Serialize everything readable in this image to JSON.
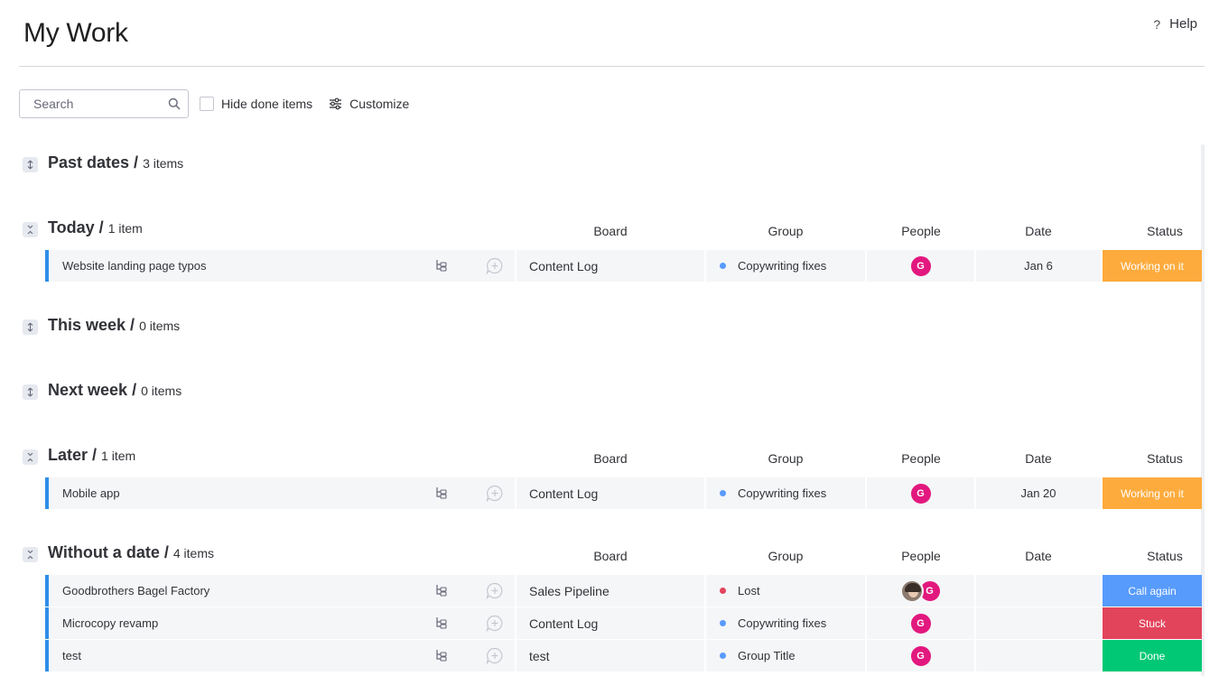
{
  "header": {
    "title": "My Work",
    "help_icon": "?",
    "help_label": "Help"
  },
  "toolbar": {
    "search_placeholder": "Search",
    "hide_done_label": "Hide done items",
    "customize_label": "Customize"
  },
  "columns": {
    "board": "Board",
    "group": "Group",
    "people": "People",
    "date": "Date",
    "status": "Status"
  },
  "groups": [
    {
      "title": "Past dates",
      "count": "3 items",
      "expanded": false
    },
    {
      "title": "Today",
      "count": "1 item",
      "expanded": true
    },
    {
      "title": "This week",
      "count": "0 items",
      "expanded": false
    },
    {
      "title": "Next week",
      "count": "0 items",
      "expanded": false
    },
    {
      "title": "Later",
      "count": "1 item",
      "expanded": true
    },
    {
      "title": "Without a date",
      "count": "4 items",
      "expanded": true
    }
  ],
  "rows": [
    {
      "name": "Website landing page typos",
      "board": "Content Log",
      "group": "Copywriting fixes",
      "group_color": "#579bfc",
      "people": [
        "G"
      ],
      "date": "Jan 6",
      "status": "Working on it",
      "status_color": "#fdab3d"
    },
    {
      "name": "Mobile app",
      "board": "Content Log",
      "group": "Copywriting fixes",
      "group_color": "#579bfc",
      "people": [
        "G"
      ],
      "date": "Jan 20",
      "status": "Working on it",
      "status_color": "#fdab3d"
    },
    {
      "name": "Goodbrothers Bagel Factory",
      "board": "Sales Pipeline",
      "group": "Lost",
      "group_color": "#e2445c",
      "people": [
        "photo",
        "G"
      ],
      "date": "",
      "status": "Call again",
      "status_color": "#579bfc"
    },
    {
      "name": "Microcopy revamp",
      "board": "Content Log",
      "group": "Copywriting fixes",
      "group_color": "#579bfc",
      "people": [
        "G"
      ],
      "date": "",
      "status": "Stuck",
      "status_color": "#e2445c"
    },
    {
      "name": "test",
      "board": "test",
      "group": "Group Title",
      "group_color": "#579bfc",
      "people": [
        "G"
      ],
      "date": "",
      "status": "Done",
      "status_color": "#00c875"
    }
  ],
  "icons": {
    "search": "search-icon",
    "customize": "sliders-icon",
    "subitems": "subitems-icon",
    "update": "add-update-icon"
  },
  "colors": {
    "accent": "#2e8ee8",
    "avatar": "#e2187e"
  }
}
